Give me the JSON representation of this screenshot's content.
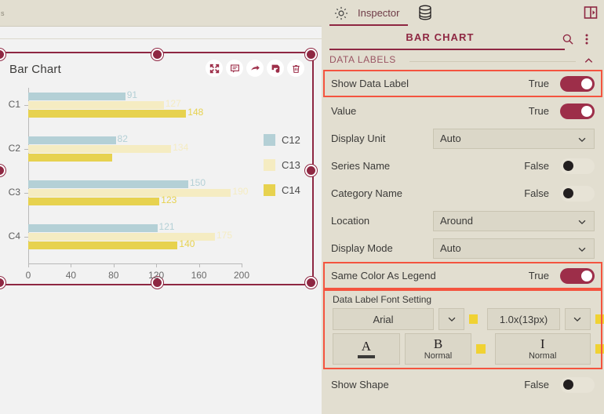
{
  "canvas": {
    "corner_glyph": "s",
    "chart_widget": {
      "title": "Bar Chart",
      "tools": [
        {
          "name": "expand-icon",
          "label": "Expand"
        },
        {
          "name": "comment-icon",
          "label": "Comment"
        },
        {
          "name": "share-icon",
          "label": "Share"
        },
        {
          "name": "save-icon",
          "label": "Save"
        },
        {
          "name": "delete-icon",
          "label": "Delete"
        }
      ]
    }
  },
  "chart_data": {
    "type": "bar",
    "orientation": "horizontal",
    "title": "Bar Chart",
    "categories": [
      "C1",
      "C2",
      "C3",
      "C4"
    ],
    "series": [
      {
        "name": "C12",
        "color": "#b4d0d6",
        "values": [
          91,
          82,
          150,
          121
        ],
        "labels": [
          "91",
          "82",
          "150",
          "121"
        ]
      },
      {
        "name": "C13",
        "color": "#f5ecc2",
        "values": [
          127,
          134,
          190,
          175
        ],
        "labels": [
          "127",
          "134",
          "190",
          "175"
        ]
      },
      {
        "name": "C14",
        "color": "#e7d24f",
        "values": [
          148,
          79,
          123,
          140
        ],
        "labels": [
          "148",
          "",
          "123",
          "140"
        ]
      }
    ],
    "xlabel": "",
    "ylabel": "",
    "xticks": [
      "0",
      "40",
      "80",
      "120",
      "160",
      "200"
    ],
    "xlim": [
      0,
      200
    ],
    "grid": false,
    "legend_position": "right",
    "data_labels": true
  },
  "inspector": {
    "tab_label": "Inspector",
    "gear_icon": "gear-icon",
    "database_icon": "database-icon",
    "collapse_icon": "panel-collapse-icon",
    "panel_title": "BAR CHART",
    "search_icon": "search-icon",
    "more_icon": "more-vertical-icon",
    "section": {
      "title": "DATA LABELS",
      "chevron": "chevron-up-icon"
    },
    "rows": [
      {
        "label": "Show Data Label",
        "type": "toggle",
        "value": "True",
        "state": "on",
        "highlighted": true
      },
      {
        "label": "Value",
        "type": "toggle",
        "value": "True",
        "state": "on",
        "highlighted": false
      },
      {
        "label": "Display Unit",
        "type": "select",
        "value": "Auto",
        "highlighted": false
      },
      {
        "label": "Series Name",
        "type": "toggle",
        "value": "False",
        "state": "off",
        "highlighted": false
      },
      {
        "label": "Category Name",
        "type": "toggle",
        "value": "False",
        "state": "off",
        "highlighted": false
      },
      {
        "label": "Location",
        "type": "select",
        "value": "Around",
        "highlighted": false
      },
      {
        "label": "Display Mode",
        "type": "select",
        "value": "Auto",
        "highlighted": false
      },
      {
        "label": "Same Color As Legend",
        "type": "toggle",
        "value": "True",
        "state": "on",
        "highlighted": true
      }
    ],
    "font_section": {
      "title": "Data Label Font Setting",
      "family": "Arial",
      "size": "1.0x(13px)",
      "bold_glyph": "B",
      "bold_value": "Normal",
      "italic_glyph": "I",
      "italic_value": "Normal",
      "underline_glyph": "A",
      "swatch_color": "#f0d233",
      "caret_icon": "chevron-down-icon"
    },
    "bottom_row": {
      "label": "Show Shape",
      "value": "False",
      "state": "off"
    }
  },
  "colors": {
    "accent": "#8e2742",
    "highlight": "#f4543f",
    "panel_bg": "#e2ded0",
    "canvas_bg": "#f2f2f2"
  }
}
